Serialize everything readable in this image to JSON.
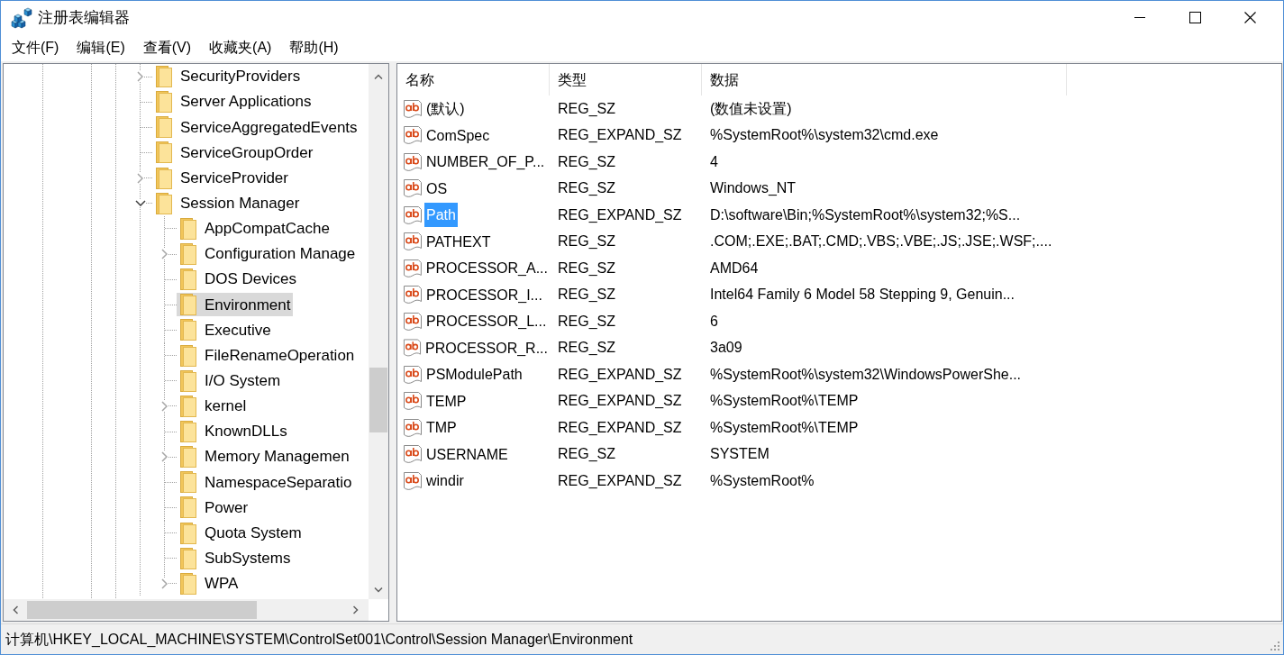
{
  "window": {
    "title": "注册表编辑器"
  },
  "menu": [
    "文件(F)",
    "编辑(E)",
    "查看(V)",
    "收藏夹(A)",
    "帮助(H)"
  ],
  "tree": {
    "items": [
      {
        "label": "SecurityProviders",
        "expandable": true,
        "expanded": false,
        "selected": false
      },
      {
        "label": "Server Applications",
        "expandable": false,
        "expanded": false,
        "selected": false
      },
      {
        "label": "ServiceAggregatedEvents",
        "expandable": false,
        "expanded": false,
        "selected": false
      },
      {
        "label": "ServiceGroupOrder",
        "expandable": false,
        "expanded": false,
        "selected": false
      },
      {
        "label": "ServiceProvider",
        "expandable": true,
        "expanded": false,
        "selected": false
      },
      {
        "label": "Session Manager",
        "expandable": true,
        "expanded": true,
        "selected": false,
        "children": [
          {
            "label": "AppCompatCache",
            "expandable": false,
            "expanded": false,
            "selected": false
          },
          {
            "label": "Configuration Manage",
            "expandable": true,
            "expanded": false,
            "selected": false
          },
          {
            "label": "DOS Devices",
            "expandable": false,
            "expanded": false,
            "selected": false
          },
          {
            "label": "Environment",
            "expandable": false,
            "expanded": false,
            "selected": true
          },
          {
            "label": "Executive",
            "expandable": false,
            "expanded": false,
            "selected": false
          },
          {
            "label": "FileRenameOperation",
            "expandable": false,
            "expanded": false,
            "selected": false
          },
          {
            "label": "I/O System",
            "expandable": false,
            "expanded": false,
            "selected": false
          },
          {
            "label": "kernel",
            "expandable": true,
            "expanded": false,
            "selected": false
          },
          {
            "label": "KnownDLLs",
            "expandable": false,
            "expanded": false,
            "selected": false
          },
          {
            "label": "Memory Managemen",
            "expandable": true,
            "expanded": false,
            "selected": false
          },
          {
            "label": "NamespaceSeparatio",
            "expandable": false,
            "expanded": false,
            "selected": false
          },
          {
            "label": "Power",
            "expandable": false,
            "expanded": false,
            "selected": false
          },
          {
            "label": "Quota System",
            "expandable": false,
            "expanded": false,
            "selected": false
          },
          {
            "label": "SubSystems",
            "expandable": false,
            "expanded": false,
            "selected": false
          },
          {
            "label": "WPA",
            "expandable": true,
            "expanded": false,
            "selected": false
          }
        ]
      }
    ]
  },
  "list": {
    "columns": [
      "名称",
      "类型",
      "数据"
    ],
    "rows": [
      {
        "name": "(默认)",
        "type": "REG_SZ",
        "data": "(数值未设置)",
        "selected": false
      },
      {
        "name": "ComSpec",
        "type": "REG_EXPAND_SZ",
        "data": "%SystemRoot%\\system32\\cmd.exe",
        "selected": false
      },
      {
        "name": "NUMBER_OF_P...",
        "type": "REG_SZ",
        "data": "4",
        "selected": false
      },
      {
        "name": "OS",
        "type": "REG_SZ",
        "data": "Windows_NT",
        "selected": false
      },
      {
        "name": "Path",
        "type": "REG_EXPAND_SZ",
        "data": "D:\\software\\Bin;%SystemRoot%\\system32;%S...",
        "selected": true
      },
      {
        "name": "PATHEXT",
        "type": "REG_SZ",
        "data": ".COM;.EXE;.BAT;.CMD;.VBS;.VBE;.JS;.JSE;.WSF;....",
        "selected": false
      },
      {
        "name": "PROCESSOR_A...",
        "type": "REG_SZ",
        "data": "AMD64",
        "selected": false
      },
      {
        "name": "PROCESSOR_I...",
        "type": "REG_SZ",
        "data": "Intel64 Family 6 Model 58 Stepping 9, Genuin...",
        "selected": false
      },
      {
        "name": "PROCESSOR_L...",
        "type": "REG_SZ",
        "data": "6",
        "selected": false
      },
      {
        "name": "PROCESSOR_R...",
        "type": "REG_SZ",
        "data": "3a09",
        "selected": false
      },
      {
        "name": "PSModulePath",
        "type": "REG_EXPAND_SZ",
        "data": "%SystemRoot%\\system32\\WindowsPowerShe...",
        "selected": false
      },
      {
        "name": "TEMP",
        "type": "REG_EXPAND_SZ",
        "data": "%SystemRoot%\\TEMP",
        "selected": false
      },
      {
        "name": "TMP",
        "type": "REG_EXPAND_SZ",
        "data": "%SystemRoot%\\TEMP",
        "selected": false
      },
      {
        "name": "USERNAME",
        "type": "REG_SZ",
        "data": "SYSTEM",
        "selected": false
      },
      {
        "name": "windir",
        "type": "REG_EXPAND_SZ",
        "data": "%SystemRoot%",
        "selected": false
      }
    ]
  },
  "status_bar": {
    "path": "计算机\\HKEY_LOCAL_MACHINE\\SYSTEM\\ControlSet001\\Control\\Session Manager\\Environment"
  }
}
